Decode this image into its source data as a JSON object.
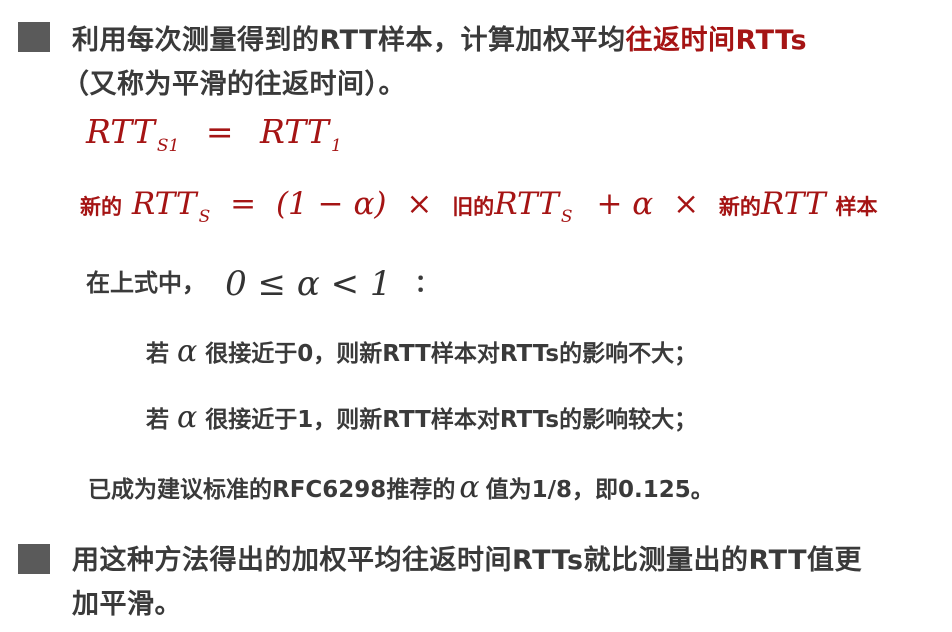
{
  "bullet1": {
    "text_part1": "利用每次测量得到的RTT样本，计算加权平均",
    "text_highlight": "往返时间RTTs",
    "text_line2": "（又称为平滑的往返时间）。"
  },
  "formula1": {
    "lhs": "RTT",
    "lhs_sub": "S1",
    "eq": "=",
    "rhs": "RTT",
    "rhs_sub": "1"
  },
  "formula2": {
    "new_label": "新的",
    "rtt": "RTT",
    "sub_s": "S",
    "eq": "=",
    "one_minus_alpha": "(1 − α)",
    "times": "×",
    "old_label": "旧的",
    "plus_alpha": "+ α",
    "new_label2": "新的",
    "rtt_sample": "RTT",
    "sample_label": "样本"
  },
  "condition": {
    "prefix": "在上式中，",
    "expr": "0 ≤ α < 1",
    "suffix": "："
  },
  "case1": {
    "ruo": "若",
    "alpha": "α",
    "text": "很接近于0，则新RTT样本对RTTs的影响不大；"
  },
  "case2": {
    "ruo": "若",
    "alpha": "α",
    "text": "很接近于1，则新RTT样本对RTTs的影响较大；"
  },
  "rfc": {
    "prefix": "已成为建议标准的RFC6298推荐的",
    "alpha": "α",
    "suffix": "值为1/8，即0.125。"
  },
  "bullet2": {
    "line1": "用这种方法得出的加权平均往返时间RTTs就比测量出的RTT值更",
    "line2": "加平滑。"
  }
}
